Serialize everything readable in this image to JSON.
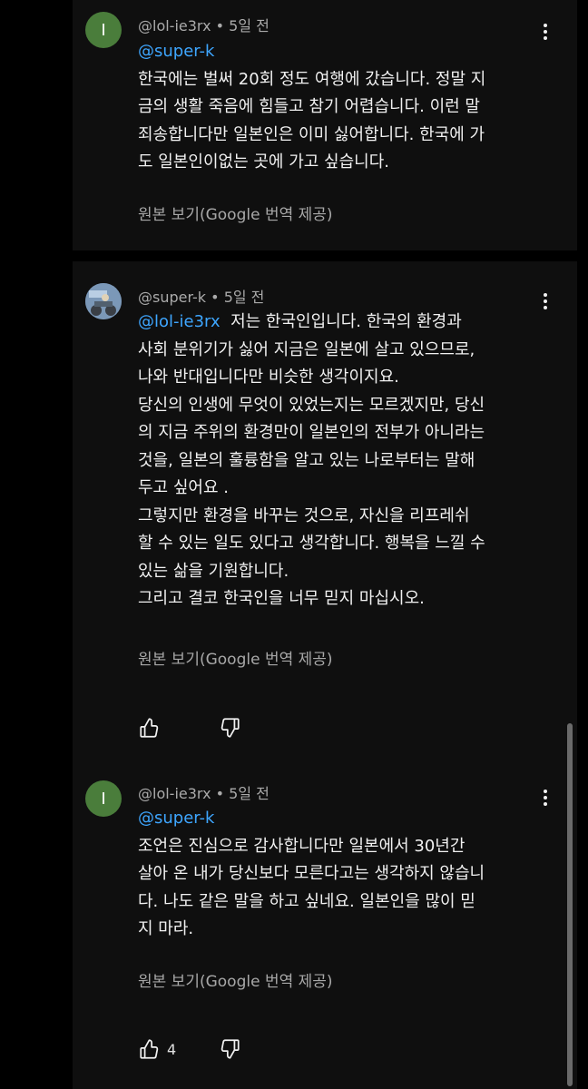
{
  "comments": [
    {
      "avatar_letter": "I",
      "author": "@lol-ie3rx",
      "time": "• 5일 전",
      "mention": "@super-k",
      "lines": [
        "한국에는 벌써 20회 정도 여행에 갔습니다. 정말 지",
        "금의 생활 죽음에 힘들고 참기 어렵습니다. 이런 말",
        "죄송합니다만 일본인은 이미 싫어합니다. 한국에 가",
        "도 일본인이없는 곳에 가고 싶습니다."
      ],
      "translate_label": "원본 보기(Google 번역 제공)"
    },
    {
      "author": "@super-k",
      "time": "• 5일 전",
      "mention": "@lol-ie3rx",
      "first_line_rest": "저는 한국인입니다. 한국의 환경과",
      "lines": [
        "사회 분위기가 싫어 지금은 일본에 살고 있으므로,",
        "나와 반대입니다만 비슷한 생각이지요.",
        "당신의 인생에 무엇이 있었는지는 모르겠지만, 당신",
        "의 지금 주위의 환경만이 일본인의 전부가 아니라는",
        "것을, 일본의 훌륭함을 알고 있는 나로부터는 말해",
        "두고 싶어요 .",
        "그렇지만 환경을 바꾸는 것으로, 자신을 리프레쉬",
        "할 수 있는 일도 있다고 생각합니다. 행복을 느낄 수",
        "있는 삶을 기원합니다.",
        "그리고 결코 한국인을 너무 믿지 마십시오."
      ],
      "translate_label": "원본 보기(Google 번역 제공)"
    },
    {
      "avatar_letter": "I",
      "author": "@lol-ie3rx",
      "time": "• 5일 전",
      "mention": "@super-k",
      "lines": [
        "조언은 진심으로 감사합니다만 일본에서 30년간",
        "살아 온 내가 당신보다 모른다고는 생각하지 않습니",
        "다. 나도 같은 말을 하고 싶네요. 일본인을 많이 믿",
        "지 마라."
      ],
      "translate_label": "원본 보기(Google 번역 제공)",
      "like_count": "4"
    }
  ],
  "icons": {
    "like": "thumbs-up-icon",
    "dislike": "thumbs-down-icon",
    "more": "more-vert-icon"
  },
  "colors": {
    "background": "#000000",
    "card": "#0f0f0f",
    "mention": "#3ea6ff",
    "avatar_green": "#4a7d3b",
    "secondary_text": "#aaaaaa"
  }
}
